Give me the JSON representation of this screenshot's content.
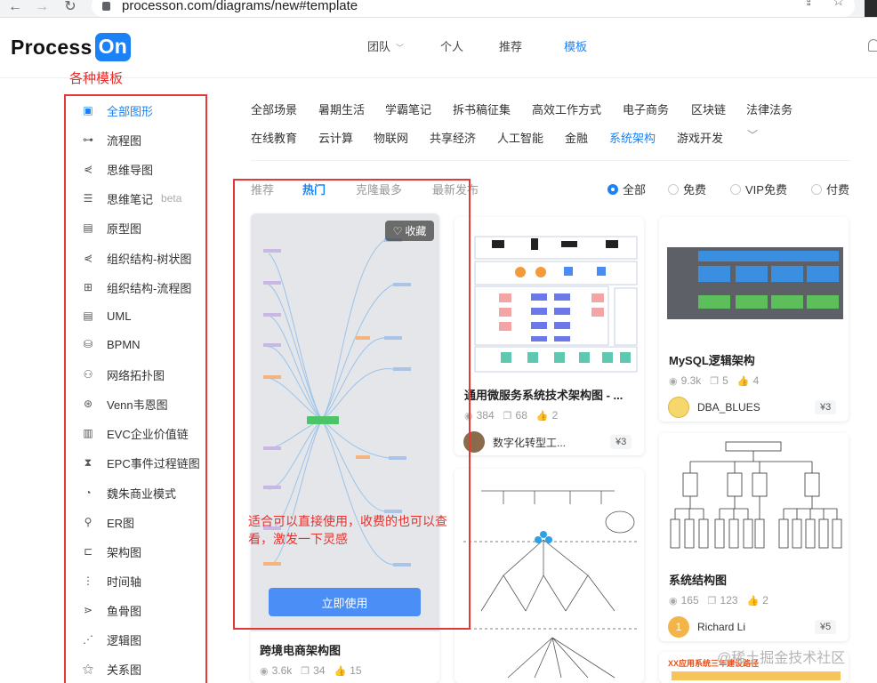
{
  "browser": {
    "url": "processon.com/diagrams/new#template"
  },
  "header": {
    "logo_text": "Process",
    "logo_badge": "On",
    "nav": [
      {
        "label": "团队",
        "has_caret": true
      },
      {
        "label": "个人"
      },
      {
        "label": "推荐"
      },
      {
        "label": "模板",
        "active": true
      }
    ]
  },
  "annotations": {
    "sidebar_note": "各种模板",
    "card_note": "适合可以直接使用，收费的也可以查看，激发一下灵感"
  },
  "sidebar": {
    "items": [
      {
        "label": "全部图形",
        "icon": "all-shapes-icon",
        "active": true
      },
      {
        "label": "流程图",
        "icon": "flowchart-icon"
      },
      {
        "label": "思维导图",
        "icon": "mindmap-icon"
      },
      {
        "label": "思维笔记",
        "icon": "notes-icon",
        "badge": "beta"
      },
      {
        "label": "原型图",
        "icon": "prototype-icon"
      },
      {
        "label": "组织结构-树状图",
        "icon": "org-tree-icon"
      },
      {
        "label": "组织结构-流程图",
        "icon": "org-flow-icon"
      },
      {
        "label": "UML",
        "icon": "uml-icon"
      },
      {
        "label": "BPMN",
        "icon": "bpmn-icon"
      },
      {
        "label": "网络拓扑图",
        "icon": "network-icon"
      },
      {
        "label": "Venn韦恩图",
        "icon": "venn-icon"
      },
      {
        "label": "EVC企业价值链",
        "icon": "evc-icon"
      },
      {
        "label": "EPC事件过程链图",
        "icon": "epc-icon"
      },
      {
        "label": "魏朱商业模式",
        "icon": "business-model-icon"
      },
      {
        "label": "ER图",
        "icon": "er-icon"
      },
      {
        "label": "架构图",
        "icon": "architecture-icon"
      },
      {
        "label": "时间轴",
        "icon": "timeline-icon"
      },
      {
        "label": "鱼骨图",
        "icon": "fishbone-icon"
      },
      {
        "label": "逻辑图",
        "icon": "logic-icon"
      },
      {
        "label": "关系图",
        "icon": "relation-icon"
      }
    ]
  },
  "categories": {
    "row1": [
      "全部场景",
      "暑期生活",
      "学霸笔记",
      "拆书稿征集",
      "高效工作方式",
      "电子商务",
      "区块链",
      "法律法务"
    ],
    "row2": [
      "在线教育",
      "云计算",
      "物联网",
      "共享经济",
      "人工智能",
      "金融",
      "系统架构",
      "游戏开发"
    ],
    "active": "系统架构"
  },
  "sort_tabs": [
    {
      "label": "推荐"
    },
    {
      "label": "热门",
      "active": true
    },
    {
      "label": "克隆最多"
    },
    {
      "label": "最新发布"
    }
  ],
  "price_filter": [
    {
      "label": "全部",
      "checked": true
    },
    {
      "label": "免费"
    },
    {
      "label": "VIP免费"
    },
    {
      "label": "付费"
    }
  ],
  "cards": {
    "c1": {
      "title": "跨境电商架构图",
      "views": "3.6k",
      "clones": "34",
      "likes": "15",
      "favorite_label": "收藏",
      "use_label": "立即使用"
    },
    "c2": {
      "title": "通用微服务系统技术架构图 - ...",
      "views": "384",
      "clones": "68",
      "likes": "2",
      "author": "数字化转型工...",
      "price": "¥3"
    },
    "c3": {
      "title": "MySQL逻辑架构",
      "views": "9.3k",
      "clones": "5",
      "likes": "4",
      "author": "DBA_BLUES",
      "price": "¥3"
    },
    "c4": {
      "title": "系统结构图",
      "views": "165",
      "clones": "123",
      "likes": "2",
      "author": "Richard Li",
      "avatar_letter": "1",
      "price": "¥5"
    },
    "c6_thumb_text": "XX应用系统三年建设路径"
  },
  "watermark": "@稀土掘金技术社区"
}
